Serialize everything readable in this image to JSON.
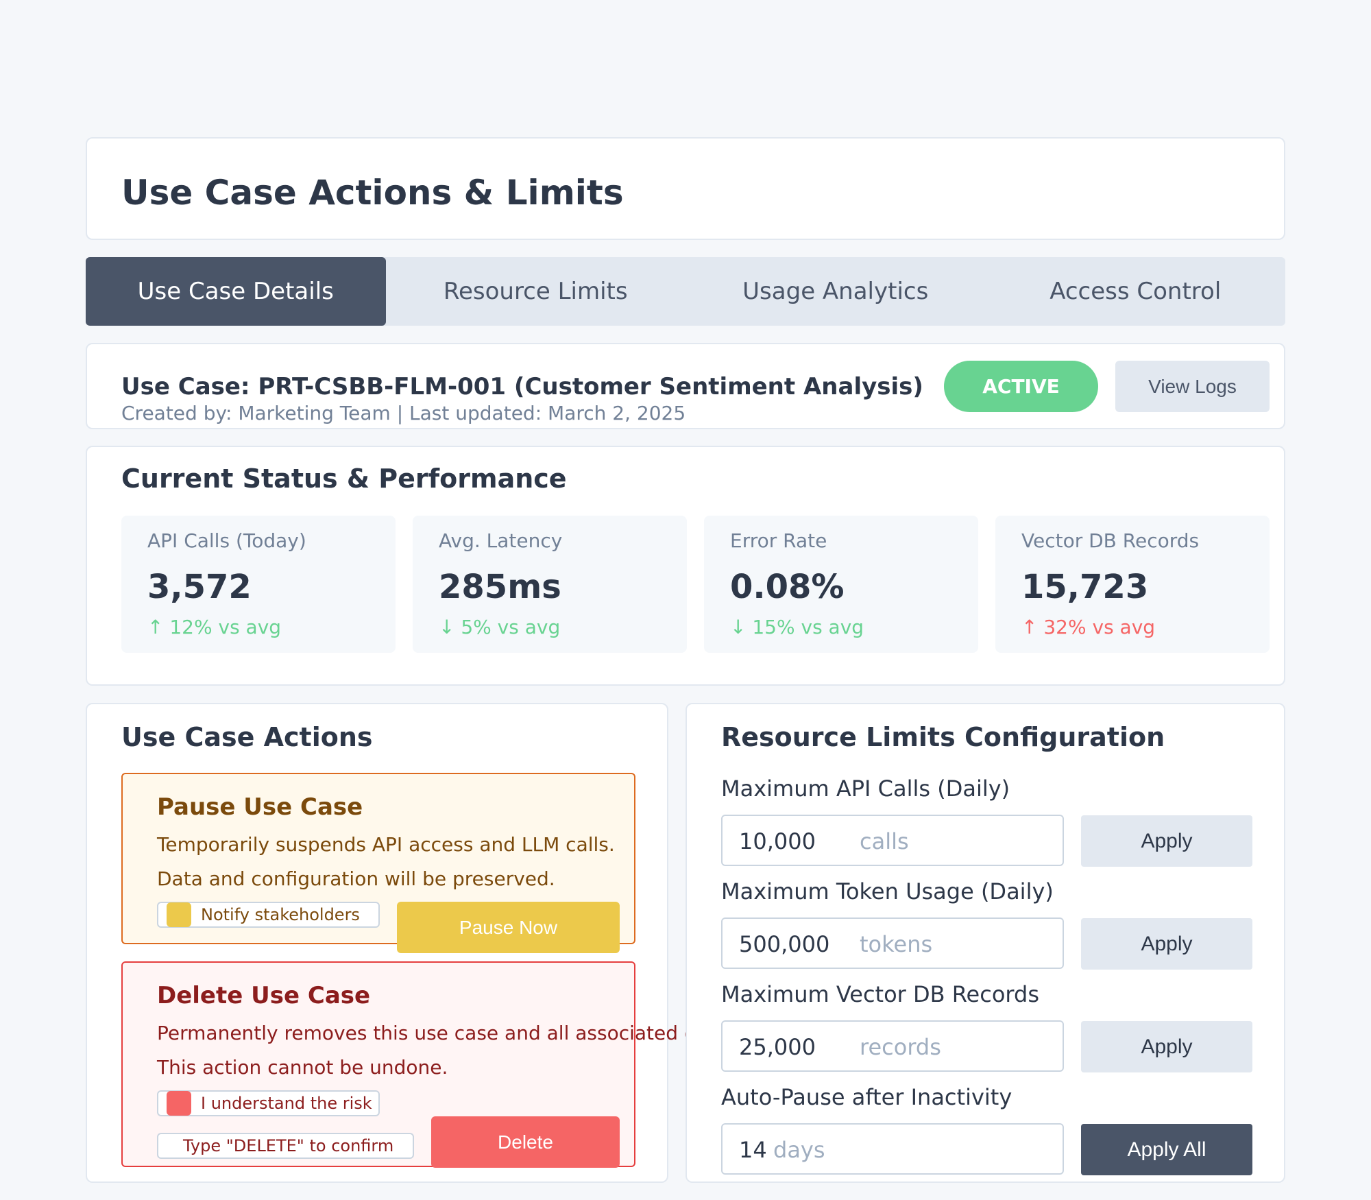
{
  "header": {
    "title": "Use Case Actions & Limits"
  },
  "tabs": [
    {
      "label": "Use Case Details",
      "active": true
    },
    {
      "label": "Resource Limits",
      "active": false
    },
    {
      "label": "Usage Analytics",
      "active": false
    },
    {
      "label": "Access Control",
      "active": false
    }
  ],
  "use_case": {
    "title": "Use Case: PRT-CSBB-FLM-001 (Customer Sentiment Analysis)",
    "meta": "Created by: Marketing Team | Last updated: March 2, 2025",
    "status": "ACTIVE",
    "view_logs_label": "View Logs"
  },
  "status_section": {
    "title": "Current Status & Performance",
    "metrics": [
      {
        "label": "API Calls (Today)",
        "value": "3,572",
        "change": "↑ 12% vs avg"
      },
      {
        "label": "Avg. Latency",
        "value": "285ms",
        "change": "↓ 5% vs avg"
      },
      {
        "label": "Error Rate",
        "value": "0.08%",
        "change": "↓ 15% vs avg"
      },
      {
        "label": "Vector DB Records",
        "value": "15,723",
        "change": "↑ 32% vs avg"
      }
    ]
  },
  "actions": {
    "title": "Use Case Actions",
    "pause": {
      "title": "Pause Use Case",
      "desc_line1": "Temporarily suspends API access and LLM calls.",
      "desc_line2": "Data and configuration will be preserved.",
      "checkbox_label": "Notify stakeholders",
      "button_label": "Pause Now"
    },
    "delete": {
      "title": "Delete Use Case",
      "desc_line1": "Permanently removes this use case and all associated data.",
      "desc_line2": "This action cannot be undone.",
      "checkbox_label": "I understand the risk",
      "confirm_placeholder": "Type \"DELETE\" to confirm",
      "button_label": "Delete"
    }
  },
  "limits": {
    "title": "Resource Limits Configuration",
    "fields": [
      {
        "label": "Maximum API Calls (Daily)",
        "value": "10,000",
        "unit": "calls",
        "button": "Apply"
      },
      {
        "label": "Maximum Token Usage (Daily)",
        "value": "500,000",
        "unit": "tokens",
        "button": "Apply"
      },
      {
        "label": "Maximum Vector DB Records",
        "value": "25,000",
        "unit": "records",
        "button": "Apply"
      },
      {
        "label": "Auto-Pause after Inactivity",
        "value": "14",
        "unit": "days",
        "button": "Apply All"
      }
    ]
  },
  "colors": {
    "active_tab": "#4a5568",
    "status_active": "#68d391",
    "pause_accent": "#ecc94b",
    "delete_accent": "#f56565",
    "change_good": "#68d391",
    "change_bad": "#f56565"
  }
}
